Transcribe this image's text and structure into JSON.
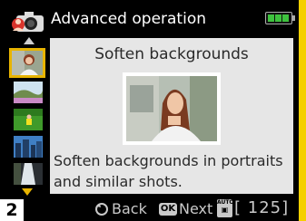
{
  "header": {
    "title": "Advanced operation",
    "mode_icon": "camera-with-portrait-icon",
    "battery_icon": "battery-full-icon"
  },
  "thumbnails": {
    "items": [
      {
        "name": "portrait-thumbnail",
        "selected": true
      },
      {
        "name": "landscape-thumbnail",
        "selected": false
      },
      {
        "name": "sports-thumbnail",
        "selected": false
      },
      {
        "name": "cityscape-thumbnail",
        "selected": false
      },
      {
        "name": "waterfall-thumbnail",
        "selected": false
      }
    ],
    "up_icon": "triangle-up-icon",
    "down_icon": "triangle-down-icon"
  },
  "panel": {
    "title": "Soften backgrounds",
    "description": "Soften backgrounds in portraits and similar shots."
  },
  "footer": {
    "page_number": "2",
    "back_label": "Back",
    "ok_label": "OK",
    "next_label": "Next",
    "auto_label": "AUTO",
    "shots_remaining": "[ 125]"
  },
  "colors": {
    "accent": "#e8b400",
    "frame": "#f5cf00",
    "panel_bg": "#e6e6e6",
    "battery": "#3ec23e"
  }
}
